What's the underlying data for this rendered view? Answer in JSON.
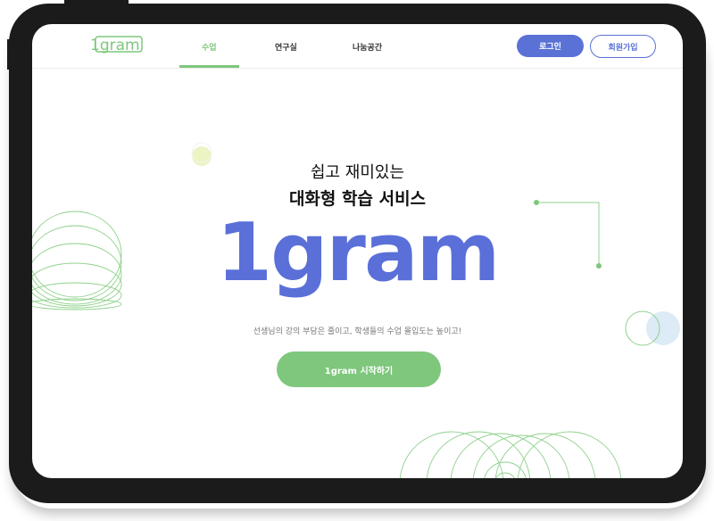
{
  "app": {
    "logo_text": "1gram"
  },
  "nav": {
    "items": [
      {
        "label": "수업",
        "active": true
      },
      {
        "label": "연구실",
        "active": false
      },
      {
        "label": "나눔공간",
        "active": false
      }
    ],
    "login_label": "로그인",
    "signup_label": "회원가입"
  },
  "hero": {
    "line1": "쉽고 재미있는",
    "line2": "대화형 학습 서비스",
    "brand": "1gram",
    "description": "선생님의 강의 부담은 줄이고, 학생들의 수업 몰입도는 높이고!",
    "cta_label": "1gram 시작하기"
  },
  "colors": {
    "accent_green": "#7ec77c",
    "accent_blue": "#5a72d6",
    "frame": "#1b1b1b"
  }
}
